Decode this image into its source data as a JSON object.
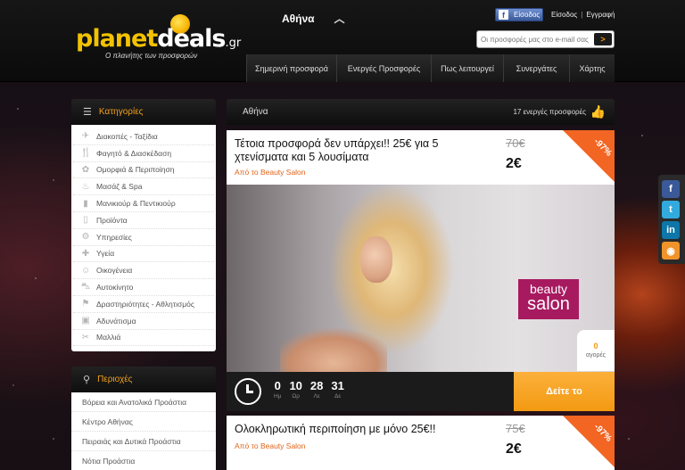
{
  "header": {
    "logo_main": "planet",
    "logo_accent": "deals",
    "logo_tld": ".gr",
    "tagline": "Ο πλανήτης των προσφορών",
    "city": "Αθήνα",
    "fb_login": "Είσοδος",
    "login": "Είσοδος",
    "register": "Εγγραφή",
    "email_placeholder": "Οι προσφορές μας στο e-mail σας",
    "go": ">"
  },
  "nav": [
    {
      "label": "Σημερινή προσφορά"
    },
    {
      "label": "Ενεργές Προσφορές"
    },
    {
      "label": "Πως λειτουργεί"
    },
    {
      "label": "Συνεργάτες"
    },
    {
      "label": "Χάρτης"
    }
  ],
  "sidebar": {
    "categories_title": "Κατηγορίες",
    "categories": [
      {
        "label": "Διακοπές - Ταξίδια",
        "icon": "plane-icon",
        "glyph": "✈"
      },
      {
        "label": "Φαγητό & Διασκέδαση",
        "icon": "cutlery-icon",
        "glyph": "🍴"
      },
      {
        "label": "Ομορφιά & Περιποίηση",
        "icon": "beauty-icon",
        "glyph": "✿"
      },
      {
        "label": "Μασάζ & Spa",
        "icon": "spa-icon",
        "glyph": "♨"
      },
      {
        "label": "Μανικιούρ & Πεντικιούρ",
        "icon": "nail-polish-icon",
        "glyph": "▮"
      },
      {
        "label": "Προϊόντα",
        "icon": "bottle-icon",
        "glyph": "▯"
      },
      {
        "label": "Υπηρεσίες",
        "icon": "gear-icon",
        "glyph": "⚙"
      },
      {
        "label": "Υγεία",
        "icon": "health-icon",
        "glyph": "✚"
      },
      {
        "label": "Οικογένεια",
        "icon": "family-icon",
        "glyph": "☺"
      },
      {
        "label": "Αυτοκίνητο",
        "icon": "car-icon",
        "glyph": "⛍"
      },
      {
        "label": "Δραστηριότητες - Αθλητισμός",
        "icon": "sports-icon",
        "glyph": "⚑"
      },
      {
        "label": "Αδυνάτισμα",
        "icon": "scale-icon",
        "glyph": "▣"
      },
      {
        "label": "Μαλλιά",
        "icon": "hair-icon",
        "glyph": "✂"
      }
    ],
    "areas_title": "Περιοχές",
    "areas": [
      {
        "label": "Βόρεια και Ανατολικά Προάστια"
      },
      {
        "label": "Κέντρο Αθήνας"
      },
      {
        "label": "Πειραιάς και Δυτικά Προάστια"
      },
      {
        "label": "Νότια Προάστια"
      }
    ]
  },
  "main": {
    "city_title": "Αθήνα",
    "active_count": "17 ενεργές προσφορές"
  },
  "deals": [
    {
      "title": "Τέτοια προσφορά δεν υπάρχει!! 25€ για 5 χτενίσματα και 5 λουσίματα",
      "merchant": "Από το Beauty Salon",
      "old_price": "70€",
      "new_price": "2€",
      "discount": "-97%",
      "brand_line1": "beauty",
      "brand_line2": "salon",
      "sold_count": "0",
      "sold_label": "αγορές",
      "timer": [
        {
          "value": "0",
          "unit": "Ημ"
        },
        {
          "value": "10",
          "unit": "Ωρ"
        },
        {
          "value": "28",
          "unit": "Λε"
        },
        {
          "value": "31",
          "unit": "Δε"
        }
      ],
      "cta": "Δείτε το"
    },
    {
      "title": "Ολοκληρωτική περιποίηση με μόνο 25€!!",
      "merchant": "Από το Beauty Salon",
      "old_price": "75€",
      "new_price": "2€",
      "discount": "-97%"
    }
  ],
  "social": [
    {
      "icon": "facebook-icon",
      "glyph": "f",
      "color": "#3b5998"
    },
    {
      "icon": "twitter-icon",
      "glyph": "t",
      "color": "#33aadd"
    },
    {
      "icon": "linkedin-icon",
      "glyph": "in",
      "color": "#0e76a8"
    },
    {
      "icon": "rss-icon",
      "glyph": "◉",
      "color": "#f0932a"
    }
  ],
  "colors": {
    "accent_orange": "#f39a12",
    "ribbon": "#f26522",
    "merchant_link": "#e0641a"
  }
}
